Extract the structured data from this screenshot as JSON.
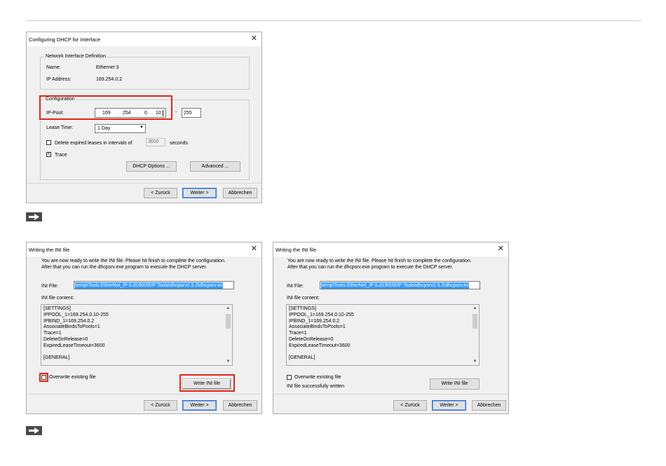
{
  "dhcp_dialog": {
    "title": "Configuring DHCP for Interface",
    "network_group_label": "Network Interface Definition",
    "name_label": "Name:",
    "name_value": "Ethernet 3",
    "ip_label": "IP Address:",
    "ip_value": "169.254.0.2",
    "config_group_label": "Configuration",
    "ip_pool_label": "IP-Pool:",
    "ip_octets": [
      "169",
      "254",
      "0",
      "10"
    ],
    "ip_dash": "-",
    "ip_pool_end": "255",
    "lease_label": "Lease Time:",
    "lease_value": "1 Day",
    "delete_expired_label": "Delete expired leases in intervals of",
    "delete_expired_checked": false,
    "interval_value": "3600",
    "seconds_label": "seconds",
    "trace_label": "Trace",
    "trace_checked": true,
    "dhcp_options_button": "DHCP Options ...",
    "advanced_button": "Advanced ...",
    "back_button": "< Zurück",
    "next_button": "Weiter >",
    "cancel_button": "Abbrechen"
  },
  "ini_dialog_left": {
    "title": "Writing the INI file",
    "intro_line1": "You are now ready to write the INI file. Please hit finish to complete the configuration.",
    "intro_line2": "After that you can run the dhcpsrv.exe program to execute the DHCP server.",
    "ini_file_label": "INI File:",
    "ini_path": "temp\\Tools EtherNet_IP ILd1900\\EIP Tools\\dhcpsrv2.5.2\\dhcpsrv.ini",
    "ini_content_label": "INI file content:",
    "ini_content": "[SETTINGS]\nIPPOOL_1=169.254.0.10-255\nIPBIND_1=169.254.0.2\nAssociateBindsToPools=1\nTrace=1\nDeleteOnRelease=0\nExpiredLeaseTimeout=3600\n\n[GENERAL]",
    "overwrite_label": "Overwrite existing file",
    "overwrite_checked": false,
    "write_button": "Write INI file",
    "back_button": "< Zurück",
    "next_button": "Weiter >",
    "cancel_button": "Abbrechen"
  },
  "ini_dialog_right": {
    "title": "Writing the INI file",
    "intro_line1": "You are now ready to write the INI file. Please hit finish to complete the configuration.",
    "intro_line2": "After that you can run the dhcpsrv.exe program to execute the DHCP server.",
    "ini_file_label": "INI File:",
    "ini_path": "temp\\Tools EtherNet_IP ILd1900\\EIP Tools\\dhcpsrv2.5.2\\dhcpsrv.ini",
    "ini_content_label": "INI file content:",
    "ini_content": "[SETTINGS]\nIPPOOL_1=169.254.0.10-255\nIPBIND_1=169.254.0.2\nAssociateBindsToPools=1\nTrace=1\nDeleteOnRelease=0\nExpiredLeaseTimeout=3600\n\n[GENERAL]",
    "overwrite_label": "Overwrite existing file",
    "overwrite_checked": false,
    "status_text": "INI file successfully written",
    "write_button": "Write INI file",
    "back_button": "< Zurück",
    "next_button": "Weiter >",
    "cancel_button": "Abbrechen"
  },
  "colors": {
    "highlight_red": "#e2231a",
    "selection_blue": "#3399ff",
    "arrow_box": "#4a4a4a",
    "dialog_bg": "#f0f0f0"
  }
}
